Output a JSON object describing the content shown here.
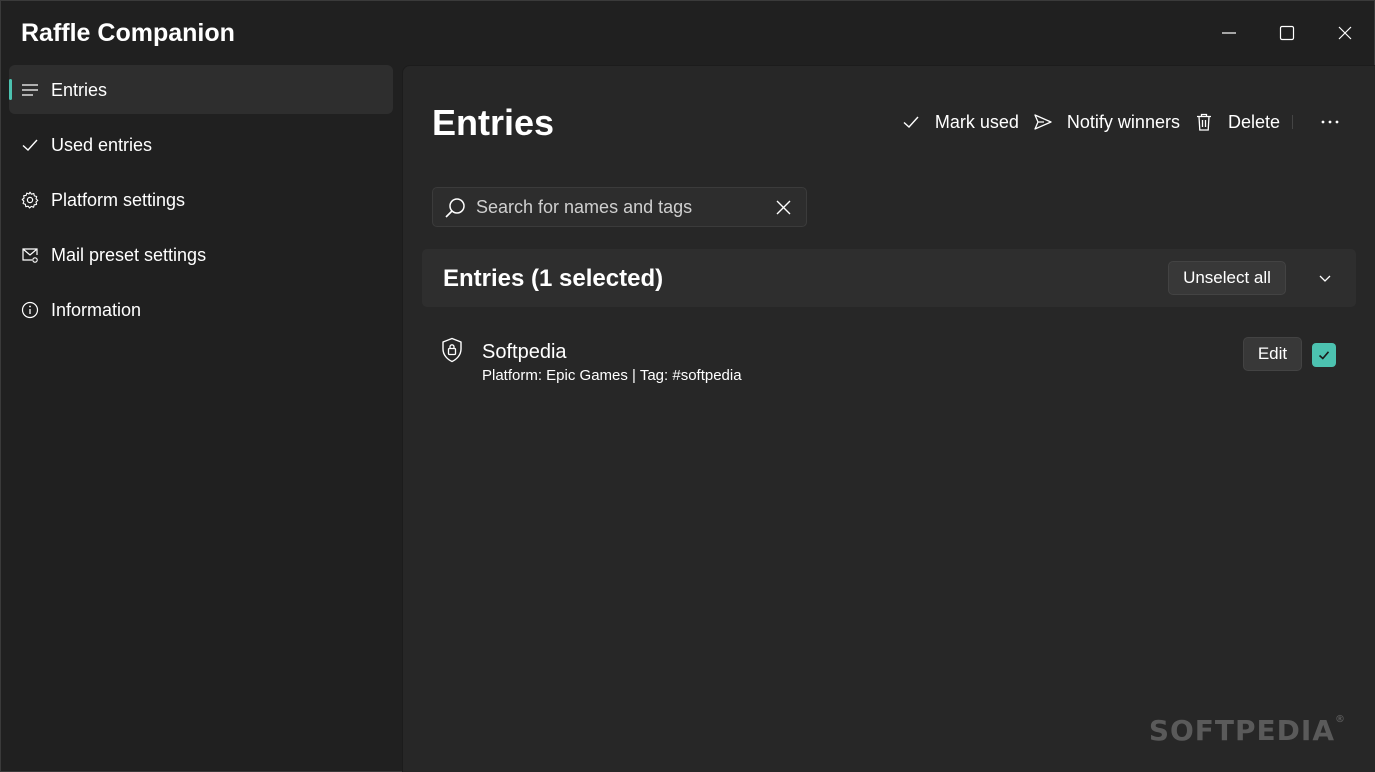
{
  "window": {
    "title": "Raffle Companion",
    "controls": [
      "minimize-icon",
      "maximize-icon",
      "close-icon"
    ]
  },
  "sidebar": {
    "items": [
      {
        "label": "Entries",
        "icon": "list-icon",
        "active": true
      },
      {
        "label": "Used entries",
        "icon": "checkmark-icon",
        "active": false
      },
      {
        "label": "Platform settings",
        "icon": "gear-icon",
        "active": false
      },
      {
        "label": "Mail preset settings",
        "icon": "mail-settings-icon",
        "active": false
      },
      {
        "label": "Information",
        "icon": "info-icon",
        "active": false
      }
    ]
  },
  "main": {
    "title": "Entries",
    "commands": {
      "mark_used": "Mark used",
      "notify_winners": "Notify winners",
      "delete": "Delete"
    },
    "search": {
      "placeholder": "Search for names and tags",
      "value": ""
    },
    "group": {
      "title": "Entries (1 selected)",
      "unselect_all": "Unselect all"
    },
    "entries": [
      {
        "name": "Softpedia",
        "meta": "Platform: Epic Games | Tag: #softpedia",
        "edit_label": "Edit",
        "selected": true,
        "icon": "shield-lock-icon"
      }
    ]
  },
  "watermark": "SOFTPEDIA",
  "colors": {
    "accent": "#4cc2b0",
    "background": "#202020",
    "content_background": "#272727"
  }
}
